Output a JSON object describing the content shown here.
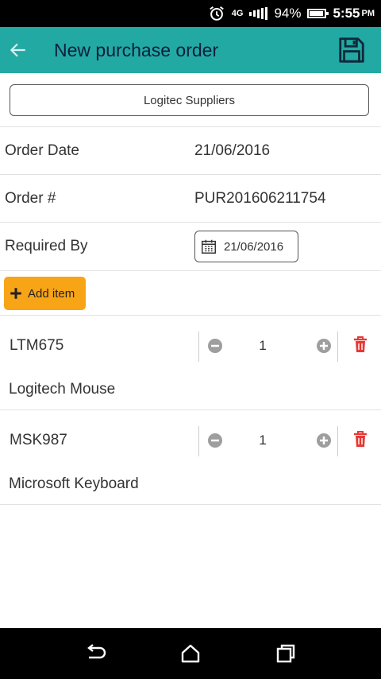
{
  "status_bar": {
    "network": "4G",
    "battery_percent": "94%",
    "battery_level": 0.94,
    "time": "5:55",
    "ampm": "PM"
  },
  "app_bar": {
    "title": "New purchase order",
    "back_icon": "arrow-left-icon",
    "save_icon": "floppy-disk-icon",
    "color": "#22a9a4"
  },
  "supplier": {
    "label": "Logitec Suppliers"
  },
  "form": {
    "order_date_label": "Order Date",
    "order_date_value": "21/06/2016",
    "order_number_label": "Order #",
    "order_number_value": "PUR201606211754",
    "required_by_label": "Required By",
    "required_by_value": "21/06/2016"
  },
  "add_item": {
    "label": "Add item",
    "color": "#f7a416"
  },
  "items": [
    {
      "code": "LTM675",
      "name": "Logitech Mouse",
      "qty": "1"
    },
    {
      "code": "MSK987",
      "name": "Microsoft Keyboard",
      "qty": "1"
    }
  ],
  "colors": {
    "delete": "#e53935",
    "stepper": "#9e9e9e"
  }
}
